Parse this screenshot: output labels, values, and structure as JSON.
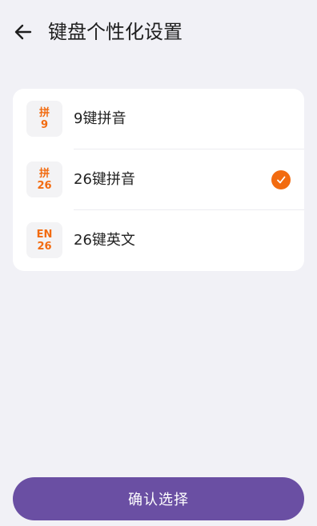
{
  "header": {
    "title": "键盘个性化设置",
    "back_icon": "arrow-left-icon"
  },
  "options": [
    {
      "badge_top": "拼",
      "badge_bottom": "9",
      "label": "9键拼音",
      "selected": false
    },
    {
      "badge_top": "拼",
      "badge_bottom": "26",
      "label": "26键拼音",
      "selected": true
    },
    {
      "badge_top": "EN",
      "badge_bottom": "26",
      "label": "26键英文",
      "selected": false
    }
  ],
  "confirm_button": {
    "label": "确认选择"
  },
  "colors": {
    "accent": "#f26b10",
    "primary": "#6a4fa3",
    "background": "#f1f1f6"
  }
}
